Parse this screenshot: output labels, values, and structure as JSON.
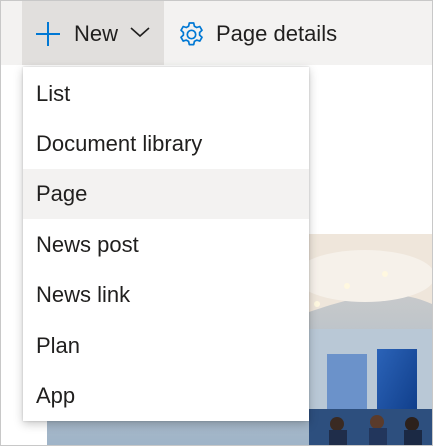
{
  "command_bar": {
    "new_label": "New",
    "new_icon": "plus-icon",
    "new_chevron_icon": "chevron-down-icon",
    "page_details_label": "Page details",
    "page_details_icon": "gear-icon",
    "accent_color": "#0078d4"
  },
  "new_menu": {
    "items": [
      {
        "label": "List"
      },
      {
        "label": "Document library"
      },
      {
        "label": "Page",
        "highlighted": true
      },
      {
        "label": "News post"
      },
      {
        "label": "News link"
      },
      {
        "label": "Plan"
      },
      {
        "label": "App"
      }
    ]
  }
}
